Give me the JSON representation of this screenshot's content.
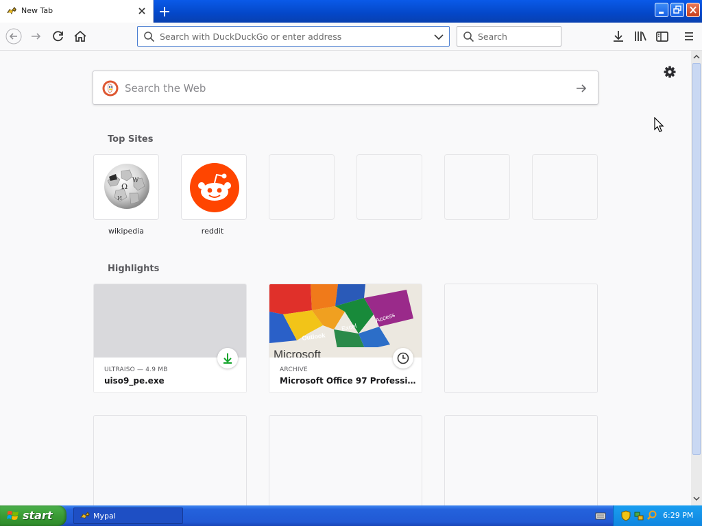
{
  "window": {
    "tab_title": "New Tab"
  },
  "navbar": {
    "url_placeholder": "Search with DuckDuckGo or enter address",
    "search_placeholder": "Search"
  },
  "newtab": {
    "web_search_placeholder": "Search the Web",
    "top_sites_title": "Top Sites",
    "top_sites": [
      {
        "label": "wikipedia",
        "icon": "wikipedia-globe-icon"
      },
      {
        "label": "reddit",
        "icon": "reddit-alien-icon"
      }
    ],
    "highlights_title": "Highlights",
    "highlights": [
      {
        "context": "ULTRAISO — 4.9 MB",
        "title": "uiso9_pe.exe",
        "badge": "download-icon"
      },
      {
        "context": "ARCHIVE",
        "title": "Microsoft Office 97 Professional...",
        "badge": "clock-icon",
        "thumb_text": "Microsoft"
      }
    ]
  },
  "taskbar": {
    "start_label": "start",
    "task_label": "Mypal",
    "clock": "6:29 PM"
  },
  "colors": {
    "accent": "#0a84ff",
    "reddit": "#ff4500",
    "download_green": "#12a32a",
    "xp_blue": "#2159d4"
  }
}
